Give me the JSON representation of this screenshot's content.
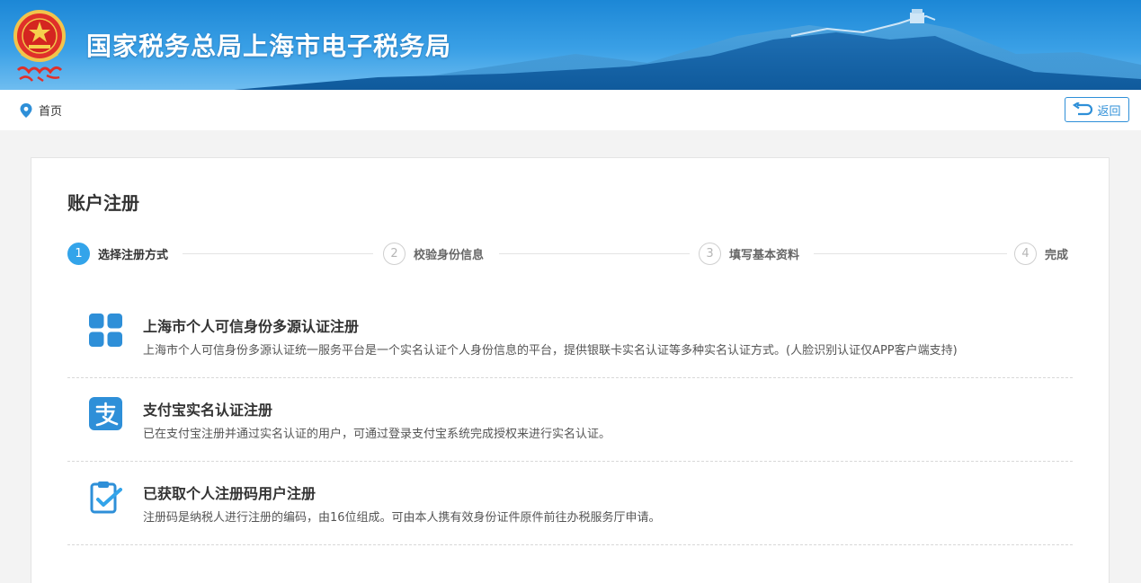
{
  "header": {
    "site_title": "国家税务总局上海市电子税务局",
    "emblem_caption": "中国税务",
    "colors": {
      "banner_top": "#1c87d6",
      "banner_bottom": "#6fbdf0",
      "accent": "#2e8fd8",
      "step_active": "#33a4ea"
    }
  },
  "nav": {
    "breadcrumb_home": "首页",
    "back_label": "返回"
  },
  "page": {
    "title": "账户注册",
    "steps": [
      {
        "number": "1",
        "label": "选择注册方式",
        "active": true
      },
      {
        "number": "2",
        "label": "校验身份信息",
        "active": false
      },
      {
        "number": "3",
        "label": "填写基本资料",
        "active": false
      },
      {
        "number": "4",
        "label": "完成",
        "active": false
      }
    ],
    "options": [
      {
        "icon": "grid-icon",
        "title": "上海市个人可信身份多源认证注册",
        "description": "上海市个人可信身份多源认证统一服务平台是一个实名认证个人身份信息的平台，提供银联卡实名认证等多种实名认证方式。(人脸识别认证仅APP客户端支持)"
      },
      {
        "icon": "alipay-icon",
        "title": "支付宝实名认证注册",
        "description": "已在支付宝注册并通过实名认证的用户，可通过登录支付宝系统完成授权来进行实名认证。"
      },
      {
        "icon": "clipboard-check-icon",
        "title": "已获取个人注册码用户注册",
        "description": "注册码是纳税人进行注册的编码，由16位组成。可由本人携有效身份证件原件前往办税服务厅申请。"
      }
    ]
  }
}
